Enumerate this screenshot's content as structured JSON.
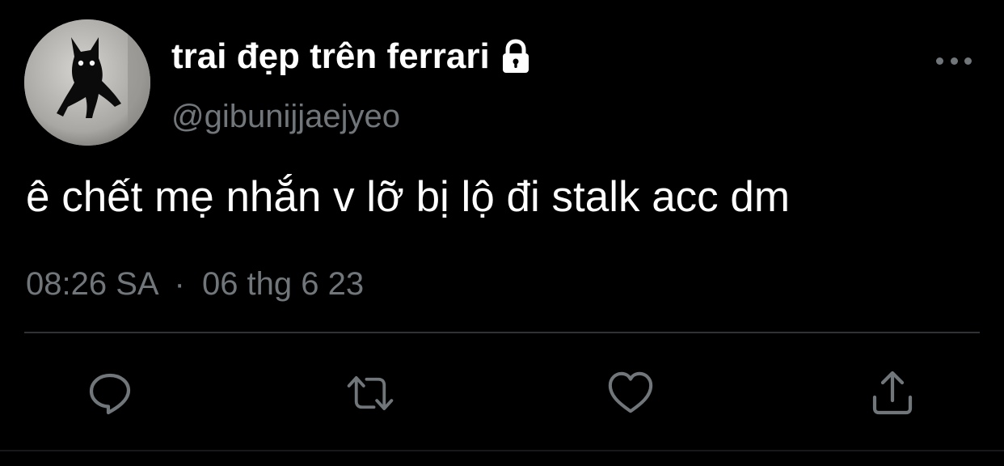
{
  "tweet": {
    "display_name": "trai đẹp trên ferrari",
    "handle": "@gibunijjaejyeo",
    "protected": true,
    "text": "ê chết mẹ nhắn v lỡ bị lộ đi stalk acc dm",
    "time": "08:26 SA",
    "separator": "·",
    "date": "06 thg 6 23"
  },
  "icons": {
    "avatar": "black-cat-avatar",
    "lock": "lock-icon",
    "more": "more-dots-icon",
    "reply": "reply-icon",
    "retweet": "retweet-icon",
    "like": "heart-icon",
    "share": "share-icon"
  },
  "colors": {
    "background": "#000000",
    "primary_text": "#ffffff",
    "secondary_text": "#71767b",
    "divider": "#2f3336",
    "icon": "#71767b"
  }
}
